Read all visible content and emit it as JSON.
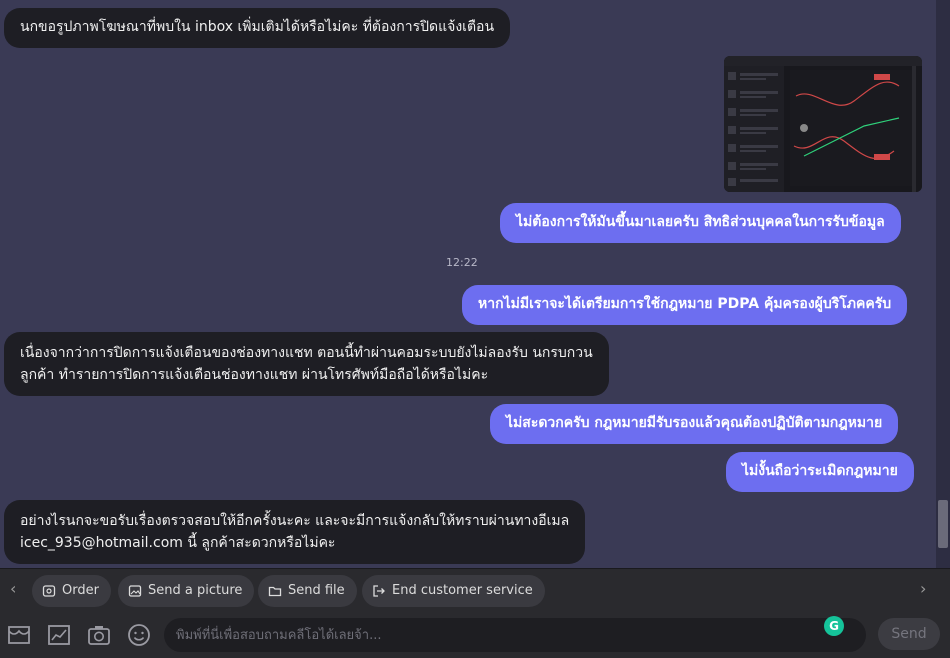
{
  "messages": {
    "m1": "นกขอรูปภาพโฆษณาที่พบใน  inbox  เพิ่มเติมได้หรือไม่คะ  ที่ต้องการปิดแจ้งเตือน",
    "m2": "ไม่ต้องการให้มันขึ้นมาเลยครับ สิทธิส่วนบุคคลในการรับข้อมูล",
    "time": "12:22",
    "m3": "หากไม่มีเราจะได้เตรียมการใช้กฎหมาย PDPA คุ้มครองผู้บริโภคครับ",
    "m4_line1": "เนื่องจากว่าการปิดการแจ้งเตือนของช่องทางแชท ตอนนี้ทำผ่านคอมระบบยังไม่ลองรับ นกรบกวน",
    "m4_line2": "ลูกค้า ทำรายการปิดการแจ้งเตือนช่องทางแชท ผ่านโทรศัพท์มือถือได้หรือไม่คะ",
    "m5": "ไม่สะดวกครับ กฎหมายมีรับรองแล้วคุณต้องปฏิบัติตามกฎหมาย",
    "m6": "ไม่งั้นถือว่าระเมิดกฎหมาย",
    "m7_line1": "อย่างไรนกจะขอรับเรื่องตรวจสอบให้อีกครั้งนะคะ และจะมีการแจ้งกลับให้ทราบผ่านทางอีเมล",
    "m7_line2": "icec_935@hotmail.com นี้ ลูกค้าสะดวกหรือไม่คะ"
  },
  "actions": {
    "order": "Order",
    "send_picture": "Send a picture",
    "send_file": "Send file",
    "end_service": "End customer service"
  },
  "input": {
    "placeholder": "พิมพ์ที่นี่เพื่อสอบถามคลีโอได้เลยจ้า...",
    "send_label": "Send"
  },
  "colors": {
    "background": "#3a3a55",
    "incoming_bubble": "#1e1e24",
    "outgoing_bubble": "#6d6ef0",
    "toolbar": "#2a2a2e"
  },
  "icons": [
    "chevron-left-icon",
    "order-icon",
    "picture-icon",
    "folder-icon",
    "exit-icon",
    "chevron-right-icon",
    "shop-icon",
    "chart-icon",
    "camera-icon",
    "emoji-icon",
    "grammarly-icon"
  ]
}
